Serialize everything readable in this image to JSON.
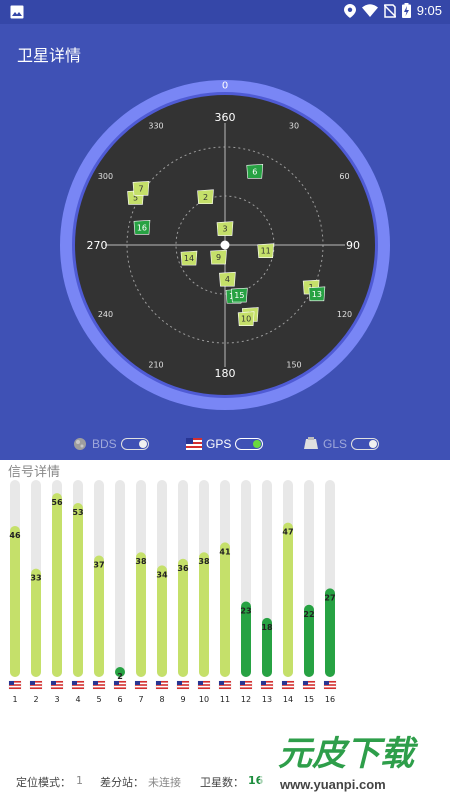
{
  "status_bar": {
    "time": "9:05",
    "icons": [
      "image-icon",
      "location-icon",
      "wifi-icon",
      "no-sim-icon",
      "battery-charging-icon"
    ]
  },
  "app_bar": {
    "title": "卫星详情"
  },
  "radar": {
    "compass_labels": [
      "0",
      "360",
      "30",
      "60",
      "90",
      "120",
      "150",
      "180",
      "210",
      "240",
      "270",
      "300",
      "330"
    ],
    "satellites": [
      {
        "id": "1",
        "azimuth": 116,
        "elevation": 20,
        "strong": false
      },
      {
        "id": "2",
        "azimuth": 338,
        "elevation": 52,
        "strong": false
      },
      {
        "id": "3",
        "azimuth": 0,
        "elevation": 78,
        "strong": false
      },
      {
        "id": "4",
        "azimuth": 176,
        "elevation": 65,
        "strong": false
      },
      {
        "id": "5",
        "azimuth": 298,
        "elevation": 16,
        "strong": false
      },
      {
        "id": "6",
        "azimuth": 22,
        "elevation": 32,
        "strong": true
      },
      {
        "id": "7",
        "azimuth": 304,
        "elevation": 16,
        "strong": false
      },
      {
        "id": "8",
        "azimuth": 160,
        "elevation": 36,
        "strong": false
      },
      {
        "id": "9",
        "azimuth": 208,
        "elevation": 80,
        "strong": false
      },
      {
        "id": "10",
        "azimuth": 164,
        "elevation": 34,
        "strong": false
      },
      {
        "id": "11",
        "azimuth": 98,
        "elevation": 60,
        "strong": false
      },
      {
        "id": "12",
        "azimuth": 170,
        "elevation": 52,
        "strong": true
      },
      {
        "id": "13",
        "azimuth": 118,
        "elevation": 14,
        "strong": true
      },
      {
        "id": "14",
        "azimuth": 250,
        "elevation": 62,
        "strong": false
      },
      {
        "id": "15",
        "azimuth": 164,
        "elevation": 52,
        "strong": true
      },
      {
        "id": "16",
        "azimuth": 282,
        "elevation": 28,
        "strong": true
      }
    ]
  },
  "toggles": [
    {
      "label": "BDS",
      "on": false
    },
    {
      "label": "GPS",
      "on": true
    },
    {
      "label": "GLS",
      "on": false
    }
  ],
  "signal": {
    "title": "信号详情",
    "bars": [
      {
        "id": "1",
        "snr": 46,
        "strong": false
      },
      {
        "id": "2",
        "snr": 33,
        "strong": false
      },
      {
        "id": "3",
        "snr": 56,
        "strong": false
      },
      {
        "id": "4",
        "snr": 53,
        "strong": false
      },
      {
        "id": "5",
        "snr": 37,
        "strong": false
      },
      {
        "id": "6",
        "snr": 2,
        "strong": true
      },
      {
        "id": "7",
        "snr": 38,
        "strong": false
      },
      {
        "id": "8",
        "snr": 34,
        "strong": false
      },
      {
        "id": "9",
        "snr": 36,
        "strong": false
      },
      {
        "id": "10",
        "snr": 38,
        "strong": false
      },
      {
        "id": "11",
        "snr": 41,
        "strong": false
      },
      {
        "id": "12",
        "snr": 23,
        "strong": true
      },
      {
        "id": "13",
        "snr": 18,
        "strong": true
      },
      {
        "id": "14",
        "snr": 47,
        "strong": false
      },
      {
        "id": "15",
        "snr": 22,
        "strong": true
      },
      {
        "id": "16",
        "snr": 27,
        "strong": true
      }
    ],
    "max_snr": 60
  },
  "footer": {
    "mode_label": "定位模式：",
    "mode_value": "1",
    "diff_label": "差分站：",
    "diff_value": "未连接",
    "sat_label": "卫星数：",
    "sat_value": "16"
  },
  "watermark": {
    "text": "元皮下载",
    "url": "www.yuanpi.com"
  },
  "colors": {
    "primary": "#3f51b5",
    "status_bar": "#3547a8",
    "radar_ring": "#7986f5",
    "radar_bg": "#333333",
    "weak_signal": "#c5e06a",
    "strong_signal": "#27a243",
    "bar_track": "#e8e8e8"
  }
}
